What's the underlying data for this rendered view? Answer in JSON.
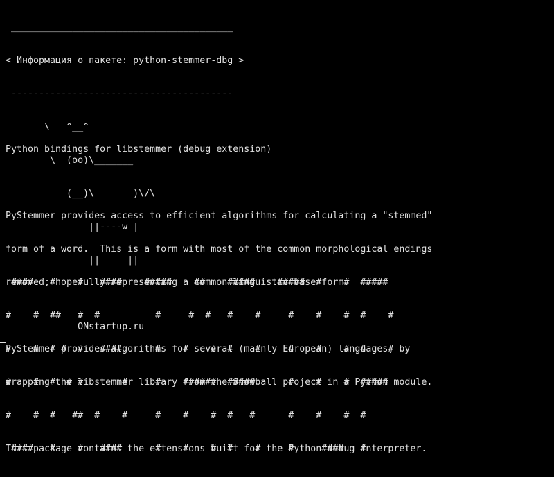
{
  "terminal": {
    "cowsay": {
      "top_border": " ________________________________________",
      "message": "< Информация о пакете: python-stemmer-dbg >",
      "bottom_border": " ----------------------------------------",
      "cow": [
        "       \\   ^__^",
        "        \\  (oo)\\_______",
        "           (__)\\       )\\/\\",
        "               ||----w |",
        "               ||     ||",
        "",
        "             ONstartup.ru"
      ]
    },
    "description": [
      "Python bindings for libstemmer (debug extension)",
      "",
      "PyStemmer provides access to efficient algorithms for calculating a \"stemmed\"",
      "form of a word.  This is a form with most of the common morphological endings",
      "removed; hopefully representing a common linguistic base form.",
      ".",
      "PyStemmer provides algorithms for several (mainly European) languages, by",
      "wrapping the libstemmer library from the Snowball project in a Python module.",
      ".",
      "This package contains the extensions built for the Python debug interpreter."
    ],
    "banner": [
      " ####   #    #   ####    #####    ##    #####    #####  #    #  #####",
      "#    #  ##   #  #          #     #  #   #    #     #    #    #  #    #",
      "#    #  # #  #   ####      #    #    #  #    #     #    #    #  #    #",
      "#    #  #  # #       #     #    ######  #####      #    #    #  #####",
      "#    #  #   ##  #    #     #    #    #  #   #      #    #    #  #",
      " ####   #    #   ####      #    #    #  #    #     #     ####   #"
    ],
    "colors": {
      "background": "#000000",
      "foreground": "#e0e0e0"
    }
  }
}
